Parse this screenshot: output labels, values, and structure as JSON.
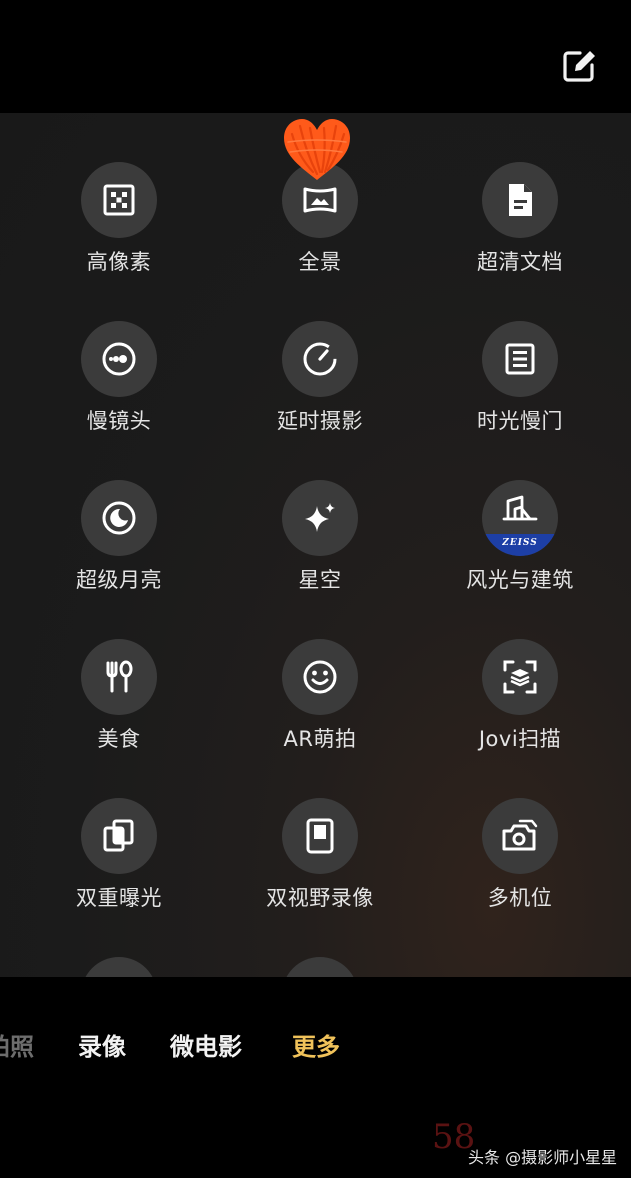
{
  "modes": [
    {
      "label": "高像素",
      "icon": "high-pixel-icon"
    },
    {
      "label": "全景",
      "icon": "panorama-icon"
    },
    {
      "label": "超清文档",
      "icon": "document-icon"
    },
    {
      "label": "慢镜头",
      "icon": "slow-motion-icon"
    },
    {
      "label": "延时摄影",
      "icon": "timelapse-icon"
    },
    {
      "label": "时光慢门",
      "icon": "slow-shutter-icon"
    },
    {
      "label": "超级月亮",
      "icon": "moon-icon"
    },
    {
      "label": "星空",
      "icon": "starry-sky-icon"
    },
    {
      "label": "风光与建筑",
      "icon": "landscape-architecture-icon",
      "badge": "ZEISS"
    },
    {
      "label": "美食",
      "icon": "food-icon"
    },
    {
      "label": "AR萌拍",
      "icon": "smiley-icon"
    },
    {
      "label": "Jovi扫描",
      "icon": "scan-icon"
    },
    {
      "label": "双重曝光",
      "icon": "double-exposure-icon"
    },
    {
      "label": "双视野录像",
      "icon": "dual-view-icon"
    },
    {
      "label": "多机位",
      "icon": "multi-camera-icon"
    }
  ],
  "tabs": {
    "photo": "拍照",
    "video": "录像",
    "micro_film": "微电影",
    "more": "更多"
  },
  "watermark": {
    "number": "58",
    "text": "头条 @摄影师小星星"
  },
  "colors": {
    "active_tab": "#f0c25a",
    "icon_circle": "#3b3b3b",
    "zeiss_blue": "#1d3fa6",
    "heart": "#ff5a1a"
  }
}
